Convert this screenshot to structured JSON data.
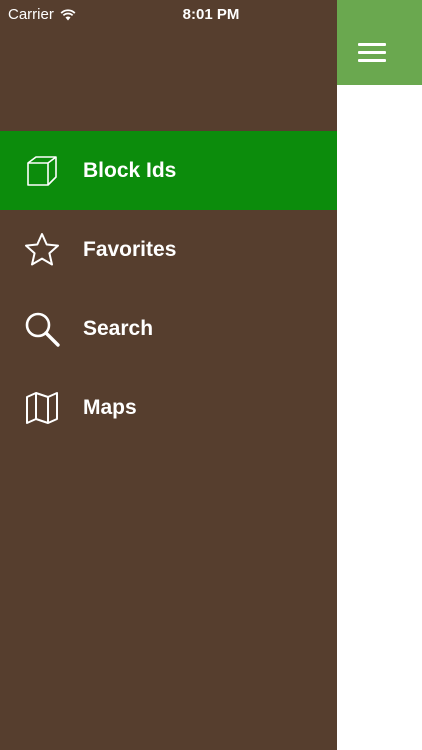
{
  "status_bar": {
    "carrier": "Carrier",
    "time": "8:01 PM"
  },
  "menu": {
    "items": [
      {
        "label": "Block Ids",
        "icon": "cube-icon",
        "active": true
      },
      {
        "label": "Favorites",
        "icon": "star-icon",
        "active": false
      },
      {
        "label": "Search",
        "icon": "search-icon",
        "active": false
      },
      {
        "label": "Maps",
        "icon": "map-icon",
        "active": false
      }
    ]
  },
  "colors": {
    "drawer_bg": "#563e2e",
    "active_item_bg": "#0c8c0c",
    "header_bg": "#6aa84f",
    "text": "#ffffff"
  }
}
